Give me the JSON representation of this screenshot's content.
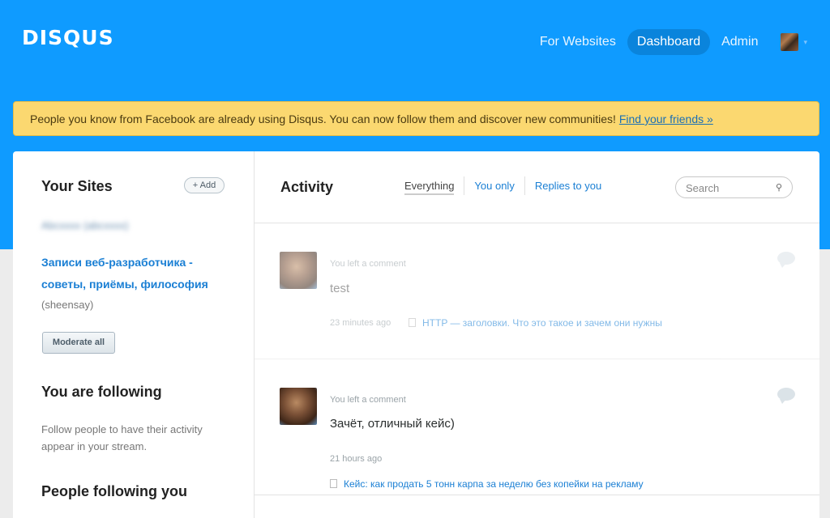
{
  "header": {
    "logo": "DISQUS",
    "nav": [
      "For Websites",
      "Dashboard",
      "Admin"
    ],
    "caret": "▾"
  },
  "notice": {
    "text": "People you know from Facebook are already using Disqus. You can now follow them and discover new communities! ",
    "link": "Find your friends »"
  },
  "sidebar": {
    "your_sites": "Your Sites",
    "add_label": "+ Add",
    "blurred_site": "Abcxxxx (abcxxxx)",
    "site_name": "Записи веб-разработчика - советы, приёмы, философия",
    "site_owner": "(sheensay)",
    "moderate_label": "Moderate all",
    "following_title": "You are following",
    "following_text": "Follow people to have their activity appear in your stream.",
    "followers_title": "People following you"
  },
  "activity": {
    "title": "Activity",
    "filters": [
      "Everything",
      "You only",
      "Replies to you"
    ],
    "search_placeholder": "Search",
    "items": [
      {
        "meta": "You left a comment",
        "text": "test",
        "time": "23 minutes ago",
        "thread": "HTTP — заголовки. Что это такое и зачем они нужны"
      },
      {
        "meta": "You left a comment",
        "text": "Зачёт, отличный кейс)",
        "time": "21 hours ago",
        "thread": "Кейс: как продать 5 тонн карпа за неделю без копейки на рекламу"
      }
    ]
  }
}
